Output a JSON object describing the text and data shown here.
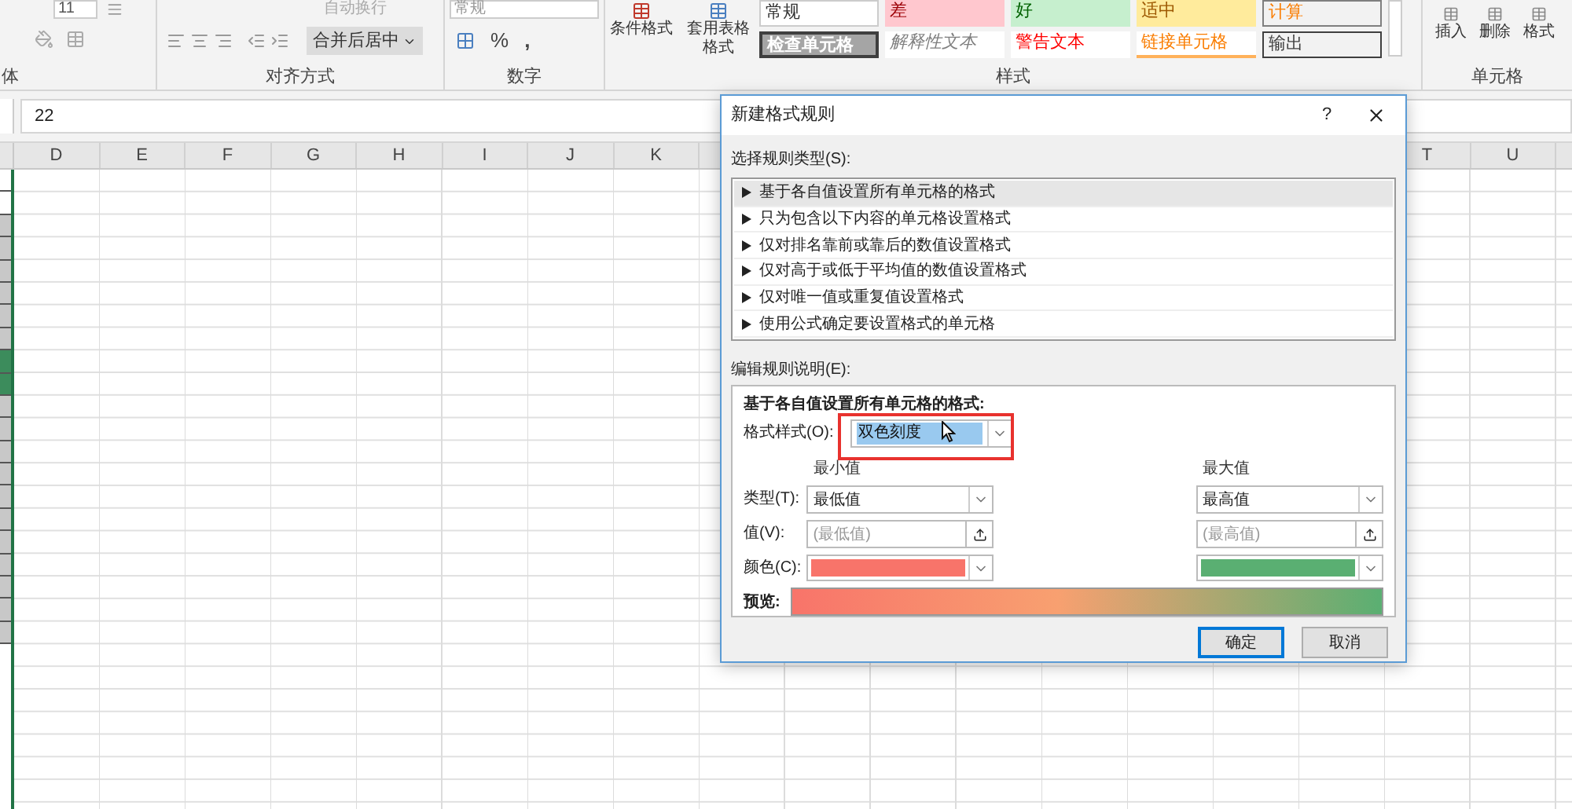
{
  "ribbon": {
    "font_group": {
      "font_size": "11",
      "label": "体"
    },
    "alignment_group": {
      "wrap_text": "自动换行",
      "merge_center": "合并后居中",
      "label": "对齐方式"
    },
    "number_group": {
      "format": "常规",
      "percent": "%",
      "comma": ",",
      "label": "数字"
    },
    "styles_group": {
      "conditional_format": "条件格式",
      "table_format": "套用表格格式",
      "label": "样式",
      "styles": [
        {
          "text": "常规",
          "kind": "normal"
        },
        {
          "text": "差",
          "kind": "bad"
        },
        {
          "text": "好",
          "kind": "good"
        },
        {
          "text": "适中",
          "kind": "neutral"
        },
        {
          "text": "计算",
          "kind": "calc"
        },
        {
          "text": "检查单元格",
          "kind": "check"
        },
        {
          "text": "解释性文本",
          "kind": "explanatory"
        },
        {
          "text": "警告文本",
          "kind": "warning"
        },
        {
          "text": "链接单元格",
          "kind": "linked"
        },
        {
          "text": "输出",
          "kind": "output"
        }
      ]
    },
    "cells_group": {
      "buttons": [
        "插入",
        "删除",
        "格式"
      ],
      "label": "单元格"
    }
  },
  "formula_bar": {
    "value": "22"
  },
  "columns_left": [
    "D",
    "E",
    "F",
    "G",
    "H",
    "I",
    "J",
    "K"
  ],
  "columns_right": [
    "T",
    "U"
  ],
  "dialog": {
    "title": "新建格式规则",
    "help": "?",
    "rule_type_label": "选择规则类型(S):",
    "rule_types": [
      {
        "text": "基于各自值设置所有单元格的格式",
        "selected": true
      },
      {
        "text": "只为包含以下内容的单元格设置格式",
        "selected": false
      },
      {
        "text": "仅对排名靠前或靠后的数值设置格式",
        "selected": false
      },
      {
        "text": "仅对高于或低于平均值的数值设置格式",
        "selected": false
      },
      {
        "text": "仅对唯一值或重复值设置格式",
        "selected": false
      },
      {
        "text": "使用公式确定要设置格式的单元格",
        "selected": false
      }
    ],
    "edit_label": "编辑规则说明(E):",
    "heading": "基于各自值设置所有单元格的格式:",
    "format_style": {
      "label": "格式样式(O):",
      "value": "双色刻度"
    },
    "row_labels": {
      "type": "类型(T):",
      "value": "值(V):",
      "color_row": "颜色(C):",
      "preview": "预览:"
    },
    "minimum": {
      "heading": "最小值",
      "type": "最低值",
      "placeholder": "(最低值)",
      "color": "#f8746a"
    },
    "maximum": {
      "heading": "最大值",
      "type": "最高值",
      "placeholder": "(最高值)",
      "color": "#5aaf72"
    },
    "buttons": [
      {
        "text": "确定",
        "default": true
      },
      {
        "text": "取消",
        "default": false
      }
    ]
  }
}
